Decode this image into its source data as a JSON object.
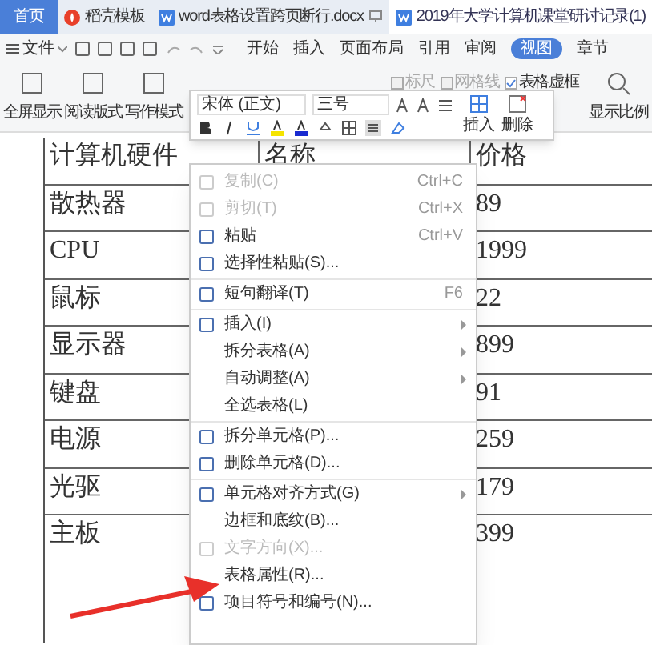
{
  "tabs": [
    {
      "label": "首页",
      "selected": false,
      "kind": "home"
    },
    {
      "label": "稻壳模板",
      "selected": false,
      "kind": "store"
    },
    {
      "label": "word表格设置跨页断行.docx",
      "selected": false,
      "kind": "doc"
    },
    {
      "label": "2019年大学计算机课堂研讨记录(1)",
      "selected": true,
      "kind": "doc"
    }
  ],
  "file_menu": "文件",
  "ribbon_tabs": [
    {
      "label": "开始",
      "selected": false
    },
    {
      "label": "插入",
      "selected": false
    },
    {
      "label": "页面布局",
      "selected": false
    },
    {
      "label": "引用",
      "selected": false
    },
    {
      "label": "审阅",
      "selected": false
    },
    {
      "label": "视图",
      "selected": true
    },
    {
      "label": "章节",
      "selected": false
    }
  ],
  "ribbon_buttons": [
    "全屏显示",
    "阅读版式",
    "写作模式"
  ],
  "view_options": [
    {
      "label": "标尺",
      "checked": false
    },
    {
      "label": "网格线",
      "checked": false
    },
    {
      "label": "表格虚框",
      "checked": true
    }
  ],
  "zoom_button": "显示比例",
  "mini_toolbar": {
    "font": "宋体 (正文)",
    "size": "三号",
    "insert": "插入",
    "delete": "删除"
  },
  "table": {
    "rows": [
      [
        "计算机硬件",
        "名称",
        "价格"
      ],
      [
        "散热器",
        "",
        "89"
      ],
      [
        "CPU",
        "",
        "1999"
      ],
      [
        "鼠标",
        "",
        "22"
      ],
      [
        "显示器",
        "",
        "899"
      ],
      [
        "键盘",
        "",
        "91"
      ],
      [
        "电源",
        "",
        "259"
      ],
      [
        "光驱",
        "",
        "179"
      ],
      [
        "主板",
        "",
        "399"
      ]
    ]
  },
  "context_menu": [
    {
      "label": "复制(C)",
      "shortcut": "Ctrl+C",
      "disabled": true,
      "icon": true,
      "submenu": false,
      "separator_after": false
    },
    {
      "label": "剪切(T)",
      "shortcut": "Ctrl+X",
      "disabled": true,
      "icon": true,
      "submenu": false,
      "separator_after": false
    },
    {
      "label": "粘贴",
      "shortcut": "Ctrl+V",
      "disabled": false,
      "icon": true,
      "submenu": false,
      "separator_after": false
    },
    {
      "label": "选择性粘贴(S)...",
      "disabled": false,
      "icon": true,
      "submenu": false,
      "separator_after": true
    },
    {
      "label": "短句翻译(T)",
      "shortcut": "F6",
      "disabled": false,
      "icon": true,
      "submenu": false,
      "separator_after": true
    },
    {
      "label": "插入(I)",
      "disabled": false,
      "icon": true,
      "submenu": true,
      "separator_after": false
    },
    {
      "label": "拆分表格(A)",
      "disabled": false,
      "icon": false,
      "submenu": true,
      "separator_after": false
    },
    {
      "label": "自动调整(A)",
      "disabled": false,
      "icon": false,
      "submenu": true,
      "separator_after": false
    },
    {
      "label": "全选表格(L)",
      "disabled": false,
      "icon": false,
      "submenu": false,
      "separator_after": true
    },
    {
      "label": "拆分单元格(P)...",
      "disabled": false,
      "icon": true,
      "submenu": false,
      "separator_after": false
    },
    {
      "label": "删除单元格(D)...",
      "disabled": false,
      "icon": true,
      "submenu": false,
      "separator_after": true
    },
    {
      "label": "单元格对齐方式(G)",
      "disabled": false,
      "icon": true,
      "submenu": true,
      "separator_after": false
    },
    {
      "label": "边框和底纹(B)...",
      "disabled": false,
      "icon": false,
      "submenu": false,
      "separator_after": false
    },
    {
      "label": "文字方向(X)...",
      "disabled": true,
      "icon": true,
      "submenu": false,
      "separator_after": false
    },
    {
      "label": "表格属性(R)...",
      "disabled": false,
      "icon": false,
      "submenu": false,
      "separator_after": false
    },
    {
      "label": "项目符号和编号(N)...",
      "disabled": false,
      "icon": true,
      "submenu": false,
      "separator_after": false
    }
  ]
}
